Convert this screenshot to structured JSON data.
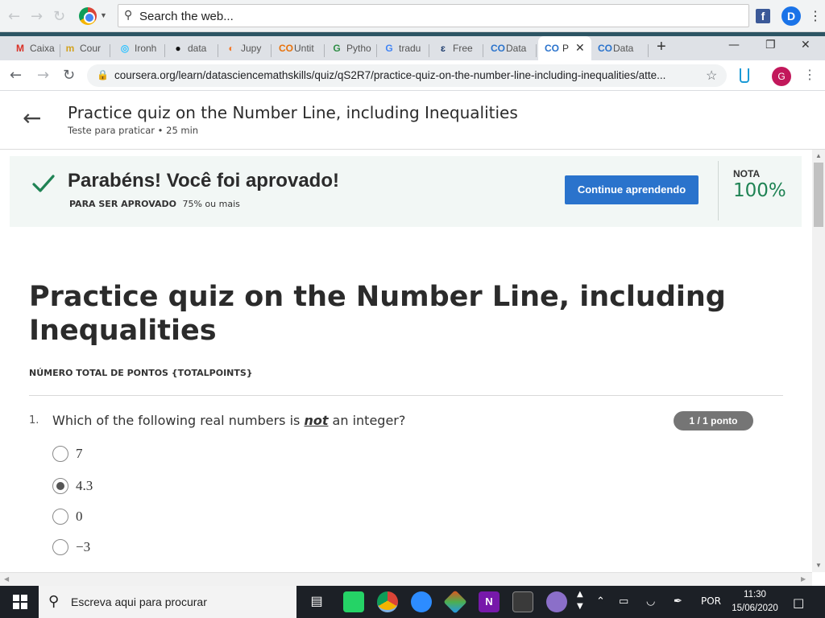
{
  "browser": {
    "search_placeholder": "Search the web...",
    "tabs": [
      {
        "label": "Caixa",
        "icon": "gmail-icon",
        "glyph": "M",
        "color": "#d93025"
      },
      {
        "label": "Cour",
        "icon": "coursera-icon",
        "glyph": "m",
        "color": "#d3a21d"
      },
      {
        "label": "Ironh",
        "icon": "ironhack-icon",
        "glyph": "◎",
        "color": "#32c3ff"
      },
      {
        "label": "data",
        "icon": "github-icon",
        "glyph": "●",
        "color": "#111111"
      },
      {
        "label": "Jupy",
        "icon": "jupyter-icon",
        "glyph": "◐",
        "color": "#f37726"
      },
      {
        "label": "Untit",
        "icon": "colab-icon",
        "glyph": "CO",
        "color": "#e8710a"
      },
      {
        "label": "Pytho",
        "icon": "geeksforgeeks-icon",
        "glyph": "G",
        "color": "#2f8d46"
      },
      {
        "label": "tradu",
        "icon": "google-icon",
        "glyph": "G",
        "color": "#4285f4"
      },
      {
        "label": "Free",
        "icon": "freecodecamp-icon",
        "glyph": "ɛ",
        "color": "#1b3a6b"
      },
      {
        "label": "Data",
        "icon": "coursera-infinity-icon",
        "glyph": "CO",
        "color": "#2a73cc"
      }
    ],
    "active_tab": {
      "label": "P",
      "icon": "coursera-infinity-icon",
      "glyph": "CO"
    },
    "last_tab": {
      "label": "Data",
      "icon": "coursera-infinity-icon",
      "glyph": "CO"
    },
    "new_tab": "+",
    "url": "coursera.org/learn/datasciencemathskills/quiz/qS2R7/practice-quiz-on-the-number-line-including-inequalities/atte...",
    "profile_initial": "G",
    "ext_badge": "D",
    "fb_glyph": "f"
  },
  "header": {
    "title": "Practice quiz on the Number Line, including Inequalities",
    "subtitle": "Teste para praticar • 25 min"
  },
  "banner": {
    "title": "Parabéns! Você foi aprovado!",
    "requirement_label": "PARA SER APROVADO",
    "requirement_value": "75% ou mais",
    "continue_label": "Continue aprendendo",
    "grade_label": "NOTA",
    "grade_value": "100%",
    "accent": "#1f8354",
    "button_color": "#2a73cc"
  },
  "quiz": {
    "title": "Practice quiz on the Number Line, including Inequalities",
    "total_points": "NÚMERO TOTAL DE PONTOS {TOTALPOINTS}",
    "question": {
      "number": "1.",
      "text_before": "Which of the following real numbers is ",
      "text_emphasis": "not",
      "text_after": " an integer?",
      "score": "1 / 1 ponto",
      "options": [
        {
          "label": "7",
          "selected": false
        },
        {
          "label": "4.3",
          "selected": true
        },
        {
          "label": "0",
          "selected": false
        },
        {
          "label": "−3",
          "selected": false
        }
      ]
    }
  },
  "taskbar": {
    "search_placeholder": "Escreva aqui para procurar",
    "language": "POR",
    "time": "11:30",
    "date": "15/06/2020"
  }
}
